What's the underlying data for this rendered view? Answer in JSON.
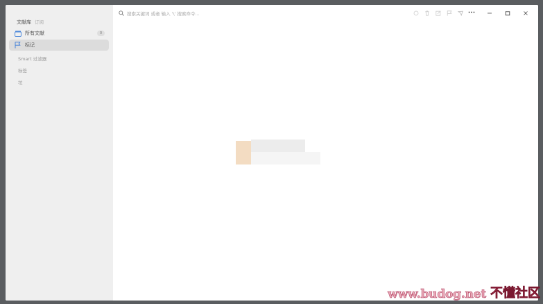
{
  "sidebar": {
    "library_title": "文献库",
    "subscribe_label": "订阅",
    "items": [
      {
        "label": "所有文献",
        "count": "0"
      },
      {
        "label": "标记"
      }
    ],
    "sections": {
      "smart": "Smart 过滤器",
      "tags": "标签",
      "trash": "垃"
    }
  },
  "search": {
    "placeholder": "搜索关键词 或者 输入 '\\' 搜索命令..."
  },
  "toolbar": {
    "icons": [
      "circle-icon",
      "trash-icon",
      "edit-icon",
      "flag-icon",
      "send-icon",
      "more-icon"
    ],
    "more_label": "···",
    "window_controls": [
      "minimize-icon",
      "maximize-icon",
      "close-icon"
    ]
  },
  "watermark": {
    "url": "www.budog.net",
    "brand": "不懂社区"
  },
  "colors": {
    "sidebar_bg": "#efefef",
    "selected_bg": "#dcdcdc",
    "accent_blue": "#3b7dd8",
    "loading_orange": "#f3dcc2",
    "frame": "#5a5d60"
  }
}
